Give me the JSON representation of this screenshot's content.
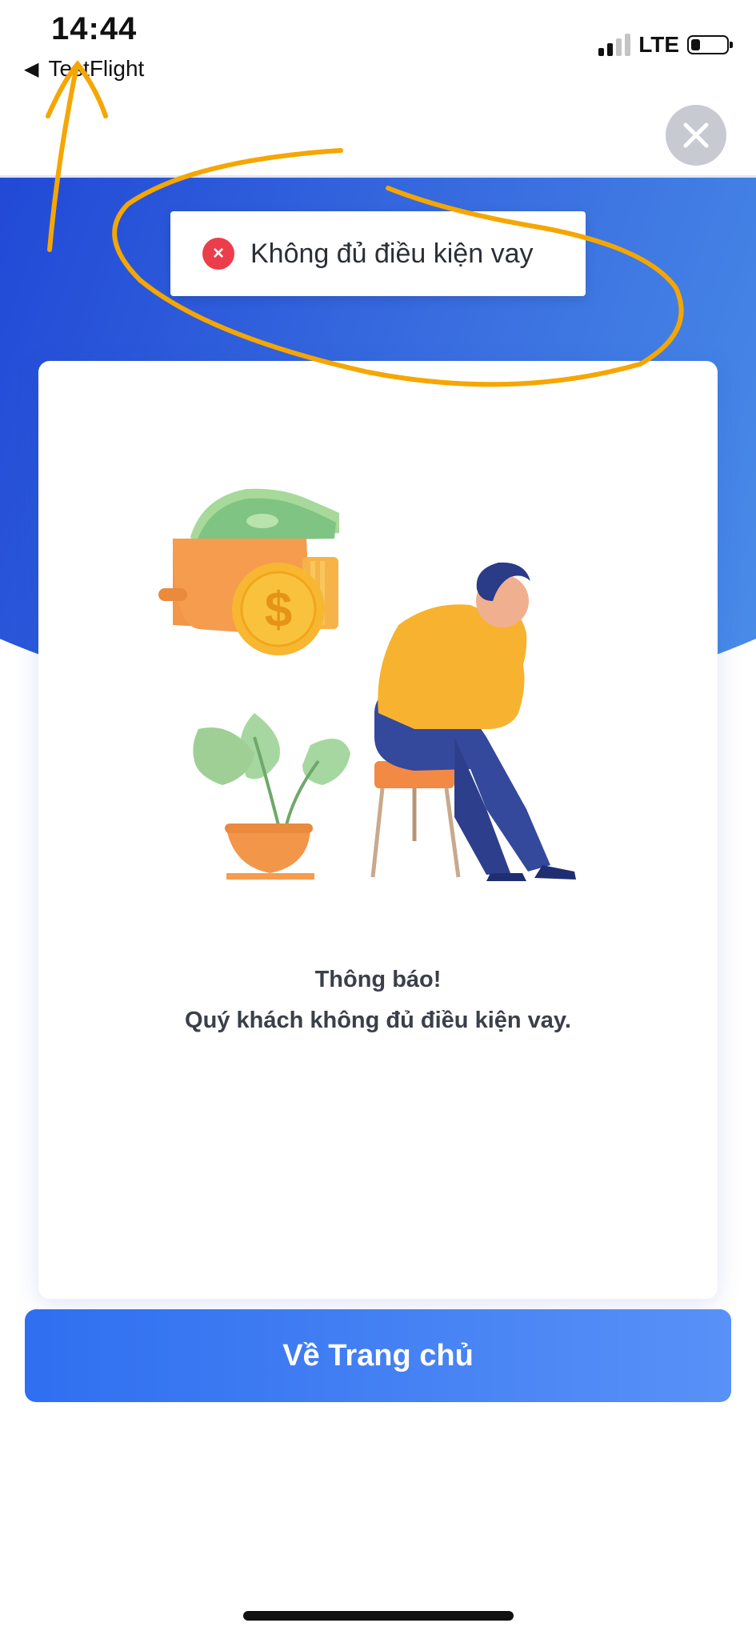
{
  "status_bar": {
    "time": "14:44",
    "back_app": "TestFlight",
    "network": "LTE",
    "signal_icon": "signal-bars-icon",
    "battery_icon": "battery-low-icon"
  },
  "toast": {
    "message": "Không đủ điều kiện vay",
    "icon": "error-x-icon",
    "icon_color": "#ec3d4b"
  },
  "close_button": {
    "icon": "close-icon"
  },
  "notice": {
    "title": "Thông báo!",
    "message": "Quý khách không đủ điều kiện vay."
  },
  "illustration": {
    "description_icon": "sad-man-wallet-illustration"
  },
  "home_button": {
    "label": "Về Trang chủ"
  },
  "colors": {
    "primary": "#2f6ff0",
    "header_gradient_start": "#2149d6",
    "header_gradient_end": "#4a8de8",
    "annotation": "#f5a600"
  }
}
